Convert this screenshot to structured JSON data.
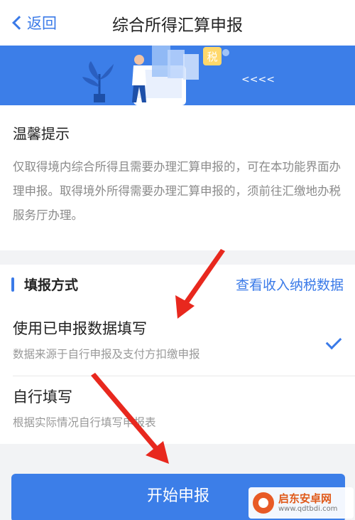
{
  "nav": {
    "back_label": "返回",
    "title": "综合所得汇算申报"
  },
  "banner": {
    "tax_badge": "税",
    "chevrons": "<<<<"
  },
  "tips": {
    "title": "温馨提示",
    "body": "仅取得境内综合所得且需要办理汇算申报的，可在本功能界面办理申报。取得境外所得需要办理汇算申报的，须前往汇缴地办税服务厅办理。"
  },
  "method": {
    "section_title": "填报方式",
    "link": "查看收入纳税数据",
    "options": [
      {
        "title": "使用已申报数据填写",
        "subtitle": "数据来源于自行申报及支付方扣缴申报",
        "selected": true
      },
      {
        "title": "自行填写",
        "subtitle": "根据实际情况自行填写申报表",
        "selected": false
      }
    ]
  },
  "start_button": "开始申报",
  "watermark": {
    "name": "启东安卓网",
    "url": "www.qdtbdi.com"
  },
  "colors": {
    "accent": "#3a7ae8",
    "annotation_arrow": "#e8281e"
  }
}
